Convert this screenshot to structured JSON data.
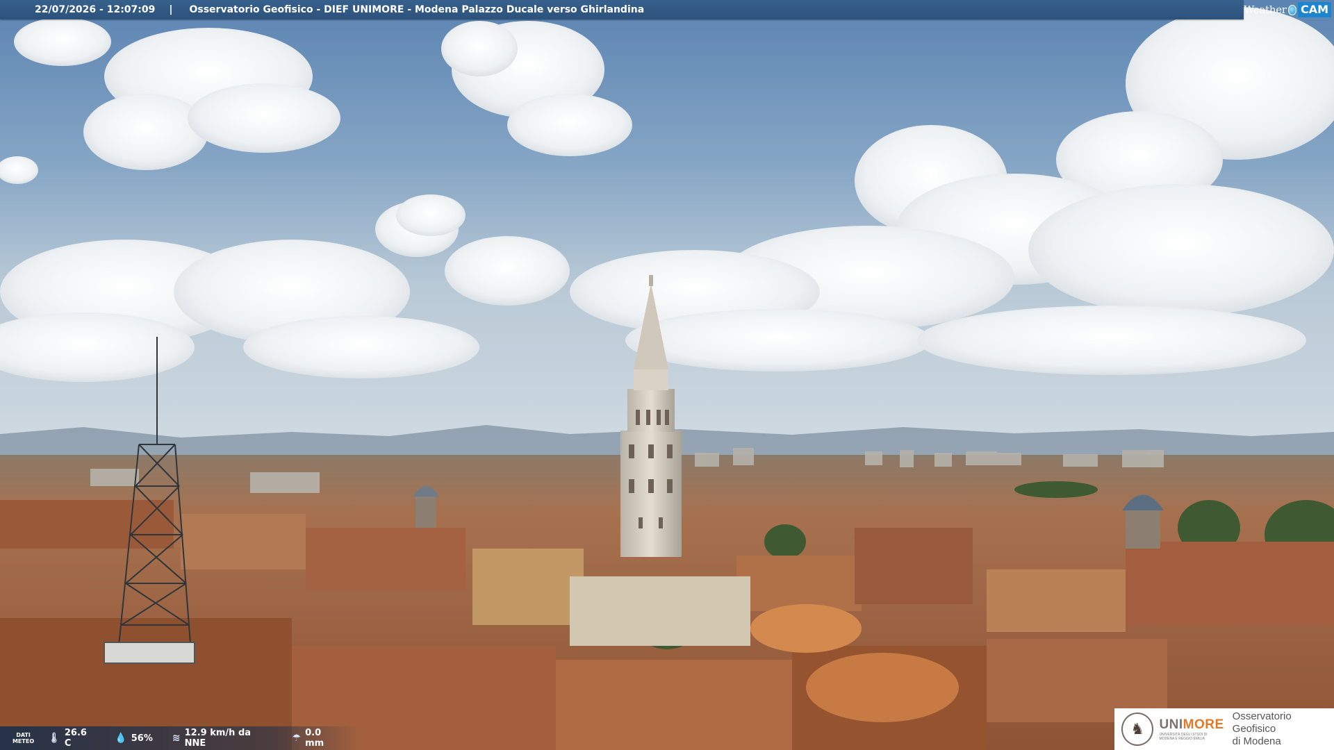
{
  "header": {
    "timestamp": "22/07/2026 - 12:07:09",
    "separator": "|",
    "title": "Osservatorio Geofisico - DIEF UNIMORE - Modena Palazzo Ducale verso Ghirlandina"
  },
  "brand": {
    "word": "Weather",
    "cam": "CAM",
    "accent_color": "#1b85d0"
  },
  "meteo": {
    "tag_line1": "DATI",
    "tag_line2": "METEO",
    "temperature": "26.6 C",
    "humidity": "56%",
    "wind": "12.9 km/h da NNE",
    "rain": "0.0 mm",
    "icons": {
      "temperature": "thermometer-icon",
      "humidity": "drop-icon",
      "wind": "wind-icon",
      "rain": "rain-icon"
    }
  },
  "logo": {
    "university": "UNI",
    "university_accent": "MORE",
    "university_sub1": "UNIVERSITÀ DEGLI STUDI DI",
    "university_sub2": "MODENA E REGGIO EMILIA",
    "observatory_line1": "Osservatorio Geofisico",
    "observatory_line2": "di Modena"
  },
  "colors": {
    "sky_top": "#5f87b3",
    "sky_horizon": "#c9d6df",
    "roof": "#a0623f",
    "banner": "#2f5681"
  }
}
